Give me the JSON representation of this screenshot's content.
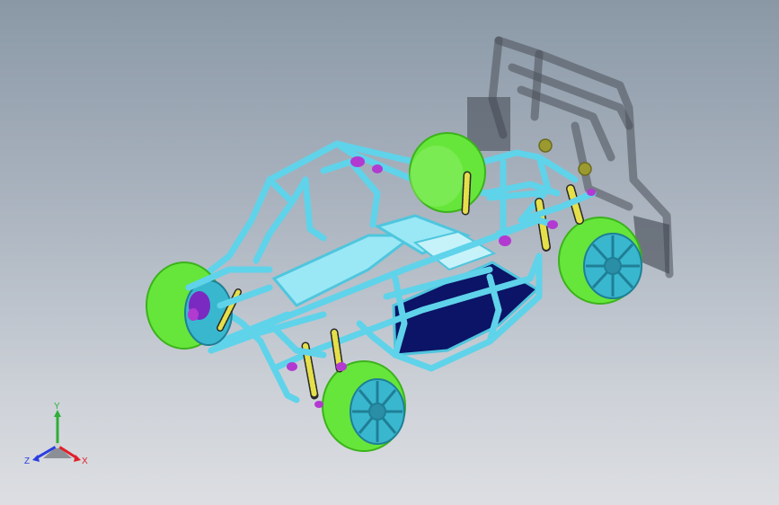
{
  "viewport": {
    "background_top": "#8a98a6",
    "background_bottom": "#dcdee2"
  },
  "model": {
    "frame_color": "#5fd3ea",
    "tire_color": "#66e63a",
    "rim_color": "#39b7cf",
    "floor_color": "#0b1466",
    "seat_color": "#86e4f2",
    "spring_color": "#e5e04a",
    "mount_color": "#b23ad1",
    "shadow_color": "#3f4650"
  },
  "triad": {
    "x_label": "X",
    "y_label": "Y",
    "z_label": "Z",
    "x_color": "#e0202a",
    "y_color": "#2fae3a",
    "z_color": "#2a3ee0"
  }
}
